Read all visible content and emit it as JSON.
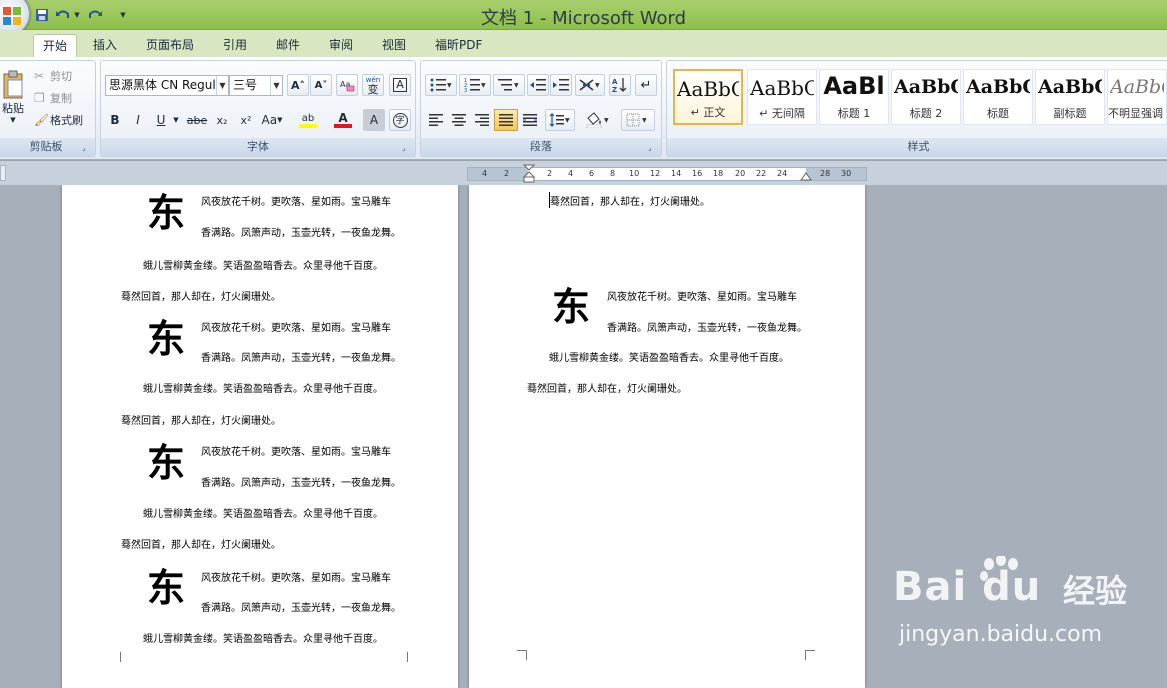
{
  "window": {
    "title": "文档 1 - Microsoft Word"
  },
  "tabs": [
    "开始",
    "插入",
    "页面布局",
    "引用",
    "邮件",
    "审阅",
    "视图",
    "福昕PDF"
  ],
  "ribbon": {
    "clipboard": {
      "paste": "粘贴",
      "cut": "剪切",
      "copy": "复制",
      "format_painter": "格式刷",
      "label": "剪贴板"
    },
    "font": {
      "font_name": "思源黑体 CN Regul",
      "font_size": "三号",
      "label": "字体",
      "bold": "B",
      "italic": "I",
      "underline": "U",
      "strike": "abe",
      "sub": "x₂",
      "sup": "x²",
      "case": "Aa",
      "grow": "A˄",
      "shrink": "A˅",
      "phonetic": "wén",
      "phonetic_char": "变",
      "border_char": "A",
      "shade_char": "A",
      "enclose_char": "字",
      "highlight": "ab",
      "color": "A"
    },
    "paragraph": {
      "label": "段落"
    },
    "styles": {
      "label": "样式",
      "items": [
        {
          "sample": "AaBbC",
          "name": "↵ 正文"
        },
        {
          "sample": "AaBbC",
          "name": "↵ 无间隔"
        },
        {
          "sample": "AaBl",
          "name": "标题 1"
        },
        {
          "sample": "AaBbC",
          "name": "标题 2"
        },
        {
          "sample": "AaBbC",
          "name": "标题"
        },
        {
          "sample": "AaBbC",
          "name": "副标题"
        },
        {
          "sample": "AaBbC",
          "name": "不明显强调"
        }
      ]
    }
  },
  "ruler": {
    "ticks": [
      "4",
      "2",
      "",
      "2",
      "4",
      "6",
      "8",
      "10",
      "12",
      "14",
      "16",
      "18",
      "20",
      "22",
      "24",
      "",
      "28",
      "30"
    ]
  },
  "document": {
    "drop_cap": "东",
    "line1": "风夜放花千树。更吹落、星如雨。宝马雕车",
    "line2": "香满路。凤箫声动，玉壶光转，一夜鱼龙舞。",
    "line3": "蛾儿雪柳黄金缕。笑语盈盈暗香去。众里寻他千百度。",
    "line4": "蓦然回首，那人却在，灯火阑珊处。"
  },
  "watermark": {
    "logo": "Bai du",
    "cn": "经验",
    "url": "jingyan.baidu.com"
  }
}
